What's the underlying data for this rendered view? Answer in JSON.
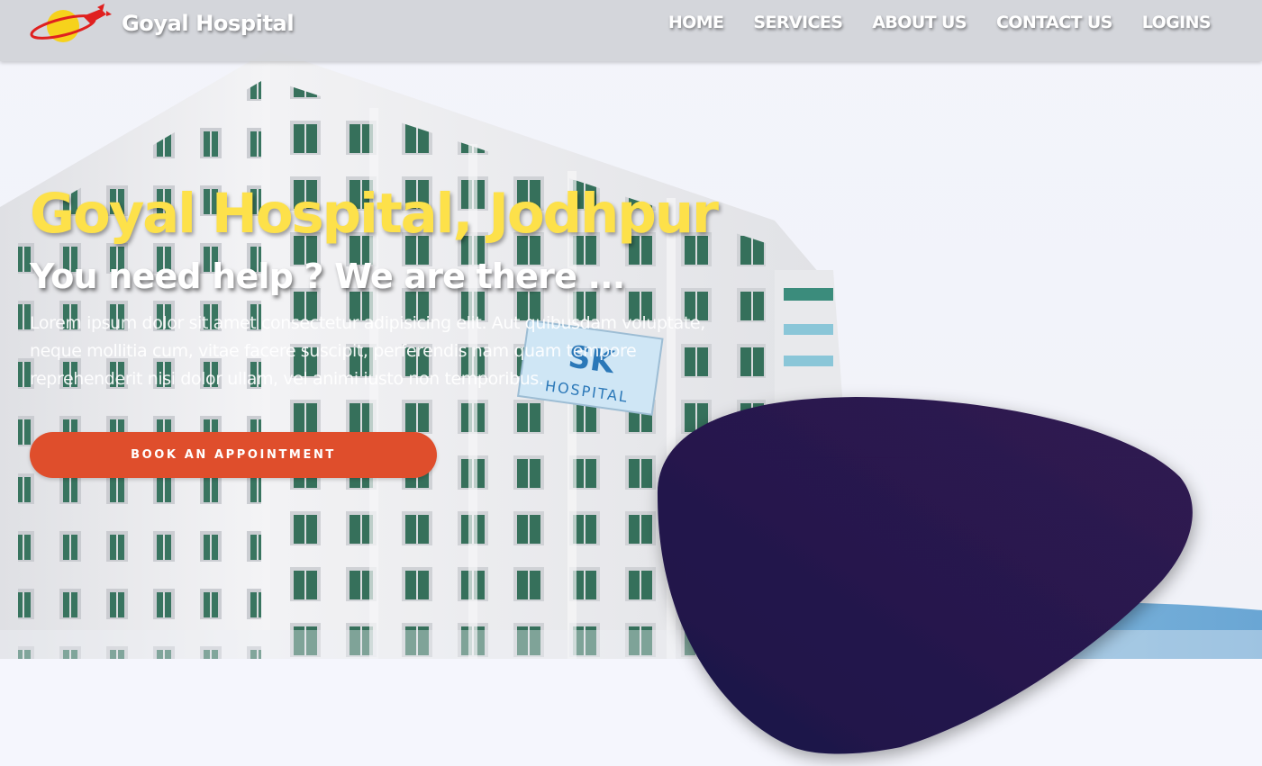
{
  "brand": {
    "name": "Goyal Hospital",
    "logo_icon": "planet-rocket-logo-icon"
  },
  "nav": {
    "items": [
      {
        "label": "HOME"
      },
      {
        "label": "SERVICES"
      },
      {
        "label": "ABOUT US"
      },
      {
        "label": "CONTACT US"
      },
      {
        "label": "LOGINS"
      }
    ]
  },
  "hero": {
    "title": "Goyal Hospital, Jodhpur",
    "subtitle": "You need help ? We are there ...",
    "paragraph": "Lorem ipsum dolor sit amet consectetur adipisicing elit. Aut quibusdam voluptate, neque mollitia cum, vitae facere suscipit, perferendis nam quam tempore reprehenderit nisi dolor ullam, vel animi iusto non temporibus.",
    "cta_label": "BOOK AN APPOINTMENT",
    "building_sign": "SK HOSPITAL"
  },
  "colors": {
    "title_yellow": "#fde14a",
    "cta_orange": "#df4e2c",
    "blob_start": "#1b1848",
    "blob_end": "#321a52",
    "navbar_bg": "#cfd1d6"
  }
}
